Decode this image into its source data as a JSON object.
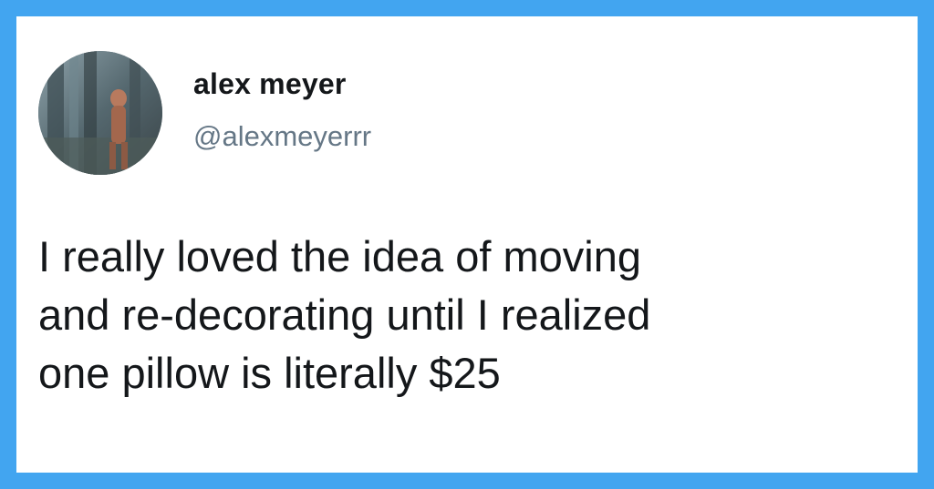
{
  "colors": {
    "border": "#42a5f0",
    "card": "#ffffff",
    "name_text": "#14171a",
    "handle_text": "#657786",
    "body_text": "#14171a"
  },
  "tweet": {
    "author": {
      "display_name": "alex meyer",
      "handle": "@alexmeyerrr",
      "avatar_icon": "profile-photo"
    },
    "text": "I really loved the idea of moving\nand re-decorating until I realized\none pillow is literally $25"
  }
}
